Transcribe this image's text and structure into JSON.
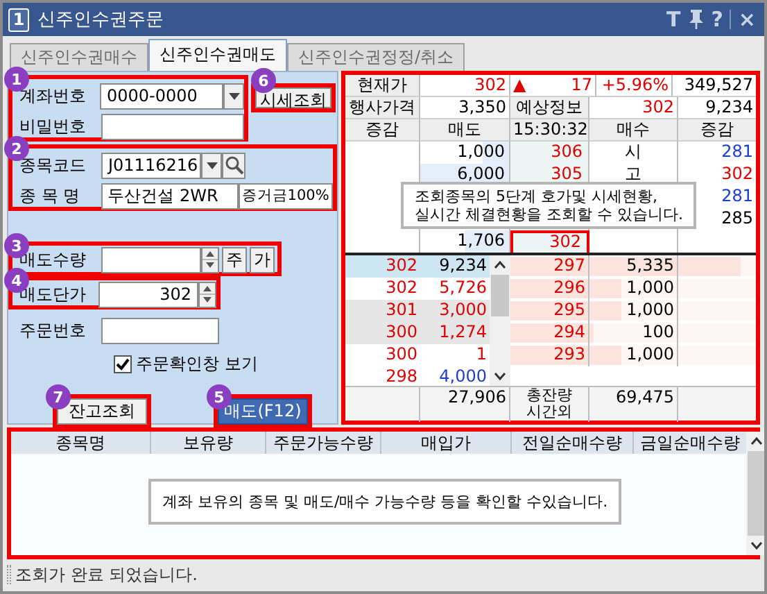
{
  "window": {
    "icon_label": "1",
    "title": "신주인수권주문",
    "controls": [
      {
        "kind": "text",
        "label": "T"
      },
      {
        "kind": "pin"
      },
      {
        "kind": "text",
        "label": "?"
      },
      {
        "kind": "separator"
      },
      {
        "kind": "text",
        "label": "×"
      }
    ]
  },
  "tabs": [
    {
      "label": "신주인수권매수",
      "selected": false
    },
    {
      "label": "신주인수권매도",
      "selected": true
    },
    {
      "label": "신주인수권정정/취소",
      "selected": false
    }
  ],
  "order_form": {
    "account": {
      "badge": "1",
      "account_label": "계좌번호",
      "account_value": "0000-0000",
      "password_label": "비밀번호"
    },
    "quote_button": {
      "badge": "6",
      "label": "시세조회"
    },
    "stock": {
      "badge": "2",
      "code_label": "종목코드",
      "code_value": "J01116216",
      "name_label": "종 목 명",
      "name_value": "두산건설 2WR",
      "margin": "증거금100%"
    },
    "quantity": {
      "badge": "3",
      "label": "매도수량",
      "buttons": [
        "주",
        "가"
      ]
    },
    "price": {
      "badge": "4",
      "label": "매도단가",
      "value": "302"
    },
    "order_number": {
      "label": "주문번호"
    },
    "confirm": {
      "label": "주문확인창 보기",
      "checked": true
    },
    "balance_button": {
      "badge": "7",
      "label": "잔고조회"
    },
    "sell_button": {
      "badge": "5",
      "label": "매도(F12)"
    }
  },
  "quote": {
    "current_label": "현재가",
    "current_price": "302",
    "change_sign": "▲",
    "change": "17",
    "change_rate": "+5.96%",
    "volume": "349,527",
    "exercise_label": "행사가격",
    "exercise_price": "3,350",
    "expected_label": "예상정보",
    "expected_price": "302",
    "expected_volume": "9,234"
  },
  "orderbook": {
    "columns": [
      "증감",
      "매도",
      "15:30:32",
      "매수",
      "증감"
    ],
    "ask_rows": [
      {
        "qty": "1,000",
        "price": "306",
        "bid_label": "시",
        "change": "281",
        "color": "#1a3fd0",
        "level": 0.3,
        "current": false
      },
      {
        "qty": "6,000",
        "price": "305",
        "bid_label": "고",
        "change": "302",
        "color": "#e00000",
        "level": 1,
        "current": false
      },
      {
        "change": "281",
        "color": "#1a3fd0"
      },
      {
        "change": "285",
        "color": "#000000"
      },
      {
        "qty": "1,706",
        "price": "302",
        "level": 0.5,
        "current": true
      }
    ],
    "ticks": [
      {
        "change": "302",
        "qty": "9,234",
        "color": "#000000",
        "selected": true,
        "shaded": false
      },
      {
        "change": "302",
        "qty": "5,726",
        "color": "#e00000",
        "selected": false,
        "shaded": false
      },
      {
        "change": "301",
        "qty": "3,000",
        "color": "#e00000",
        "selected": false,
        "shaded": true
      },
      {
        "change": "300",
        "qty": "1,274",
        "color": "#e00000",
        "selected": false,
        "shaded": true
      },
      {
        "change": "300",
        "qty": "1",
        "color": "#e00000",
        "selected": false,
        "shaded": false
      },
      {
        "change": "298",
        "qty": "4,000",
        "color": "#1a3fd0",
        "selected": false,
        "shaded": false
      }
    ],
    "bid_rows": [
      {
        "price": "297",
        "qty": "5,335",
        "level": 0.94
      },
      {
        "price": "296",
        "qty": "1,000",
        "level": 0.45
      },
      {
        "price": "295",
        "qty": "1,000",
        "level": 0.45
      },
      {
        "price": "294",
        "qty": "100",
        "level": 0.34
      },
      {
        "price": "293",
        "qty": "1,000",
        "level": 0.45
      }
    ],
    "summary": {
      "ask_total": "27,906",
      "labels": [
        "총잔량",
        "시간외"
      ],
      "bid_total": "69,475"
    },
    "guide": [
      "조회종목의 5단계 호가및 시세현황,",
      "실시간 체결현황을 조회할 수 있습니다."
    ]
  },
  "holdings": {
    "columns": [
      "종목명",
      "보유량",
      "주문가능수량",
      "매입가",
      "전일순매수량",
      "금일순매수량"
    ],
    "guide": "계좌 보유의 종목 및 매도/매수 가능수량 등을 확인할 수있습니다."
  },
  "status_bar": "조회가 완료 되었습니다."
}
